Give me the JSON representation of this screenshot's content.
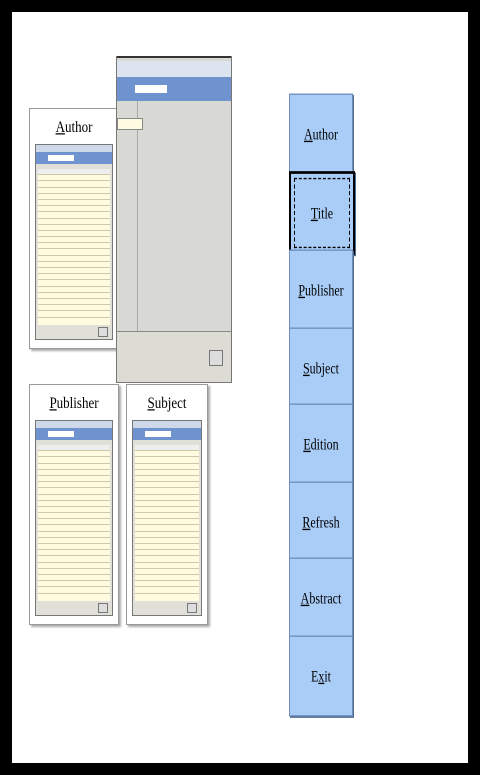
{
  "buttons": [
    {
      "label": "Author",
      "mnemonic": "A"
    },
    {
      "label": "Title",
      "mnemonic": "T"
    },
    {
      "label": "Publisher",
      "mnemonic": "P"
    },
    {
      "label": "Subject",
      "mnemonic": "S"
    },
    {
      "label": "Edition",
      "mnemonic": "E"
    },
    {
      "label": "Refresh",
      "mnemonic": "R"
    },
    {
      "label": "Abstract",
      "mnemonic": "A"
    },
    {
      "label": "Exit",
      "mnemonic": "x"
    }
  ],
  "selected_button": "Title",
  "thumbnails": {
    "author": {
      "title": "Author"
    },
    "publisher": {
      "title": "Publisher"
    },
    "subject": {
      "title": "Subject"
    }
  },
  "colors": {
    "button_fill": "#a9cdf7",
    "search_band": "#6f93cf",
    "grid_bg": "#fffbe0",
    "frame": "#000000"
  }
}
